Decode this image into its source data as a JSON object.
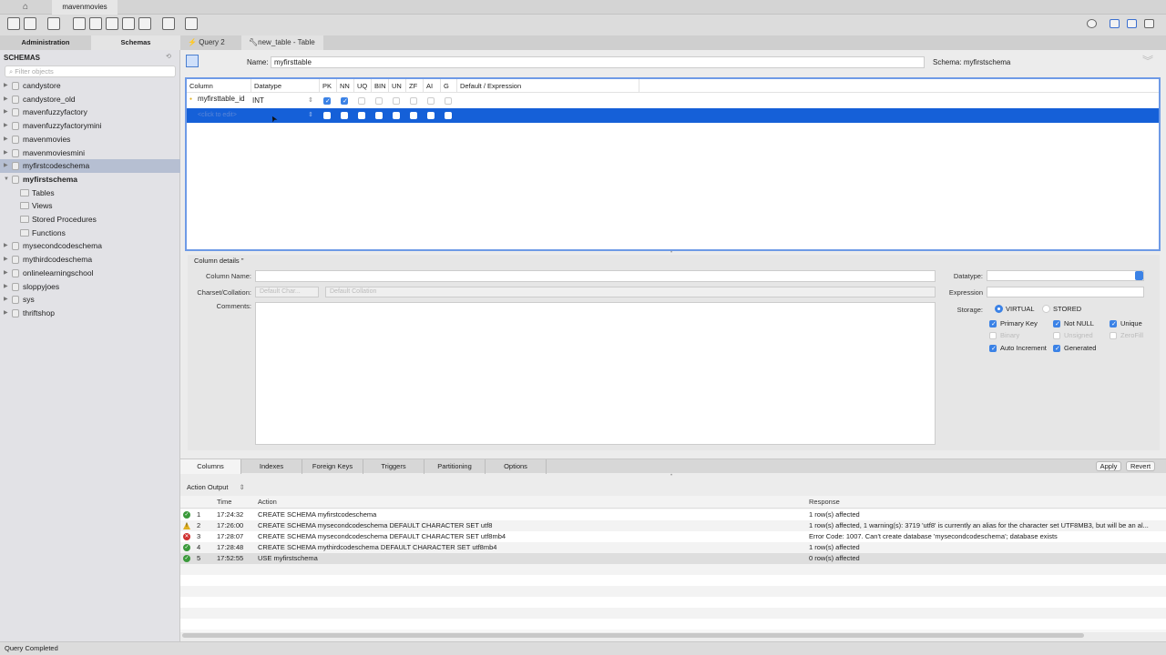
{
  "topbar": {
    "home_icon": "home-icon",
    "connection_tab": "mavenmovies"
  },
  "sidebar": {
    "tabs": [
      "Administration",
      "Schemas"
    ],
    "title": "SCHEMAS",
    "filter_placeholder": "Filter objects",
    "items": [
      {
        "label": "candystore",
        "level": 0
      },
      {
        "label": "candystore_old",
        "level": 0
      },
      {
        "label": "mavenfuzzyfactory",
        "level": 0
      },
      {
        "label": "mavenfuzzyfactorymini",
        "level": 0
      },
      {
        "label": "mavenmovies",
        "level": 0
      },
      {
        "label": "mavenmoviesmini",
        "level": 0
      },
      {
        "label": "myfirstcodeschema",
        "level": 0,
        "selected": true
      },
      {
        "label": "myfirstschema",
        "level": 0,
        "expanded": true,
        "bold": true
      },
      {
        "label": "Tables",
        "level": 1
      },
      {
        "label": "Views",
        "level": 1
      },
      {
        "label": "Stored Procedures",
        "level": 1
      },
      {
        "label": "Functions",
        "level": 1
      },
      {
        "label": "mysecondcodeschema",
        "level": 0
      },
      {
        "label": "mythirdcodeschema",
        "level": 0
      },
      {
        "label": "onlinelearningschool",
        "level": 0
      },
      {
        "label": "sloppyjoes",
        "level": 0
      },
      {
        "label": "sys",
        "level": 0
      },
      {
        "label": "thriftshop",
        "level": 0
      }
    ]
  },
  "editor": {
    "tabs": [
      "Query 2",
      "new_table - Table"
    ],
    "name_label": "Name:",
    "name_value": "myfirsttable",
    "schema_label": "Schema:",
    "schema_value": "myfirstschema",
    "grid_headers": [
      "Column",
      "Datatype",
      "PK",
      "NN",
      "UQ",
      "BIN",
      "UN",
      "ZF",
      "AI",
      "G",
      "Default / Expression"
    ],
    "rows": [
      {
        "column": "myfirsttable_id",
        "datatype": "INT",
        "flags": [
          true,
          true,
          false,
          false,
          false,
          false,
          false,
          false
        ]
      },
      {
        "column": "<click to edit>",
        "datatype": "",
        "flags": [
          false,
          false,
          false,
          false,
          false,
          false,
          false,
          false
        ],
        "selected": true
      }
    ]
  },
  "details": {
    "title": "Column details ''",
    "column_name_label": "Column Name:",
    "charset_label": "Charset/Collation:",
    "charset_value": "Default Char...",
    "collation_value": "Default Collation",
    "comments_label": "Comments:",
    "datatype_label": "Datatype:",
    "expression_label": "Expression",
    "storage_label": "Storage:",
    "storage_options": [
      "VIRTUAL",
      "STORED"
    ],
    "storage_selected": "VIRTUAL",
    "checks": [
      {
        "label": "Primary Key",
        "checked": true,
        "enabled": true
      },
      {
        "label": "Not NULL",
        "checked": true,
        "enabled": true
      },
      {
        "label": "Unique",
        "checked": true,
        "enabled": true
      },
      {
        "label": "Binary",
        "checked": false,
        "enabled": false
      },
      {
        "label": "Unsigned",
        "checked": false,
        "enabled": false
      },
      {
        "label": "ZeroFill",
        "checked": false,
        "enabled": false
      },
      {
        "label": "Auto Increment",
        "checked": true,
        "enabled": true
      },
      {
        "label": "Generated",
        "checked": true,
        "enabled": true
      }
    ]
  },
  "bottom_tabs": [
    "Columns",
    "Indexes",
    "Foreign Keys",
    "Triggers",
    "Partitioning",
    "Options"
  ],
  "buttons": {
    "apply": "Apply",
    "revert": "Revert"
  },
  "output": {
    "selector": "Action Output",
    "headers": [
      "Time",
      "Action",
      "Response"
    ],
    "rows": [
      {
        "status": "ok",
        "n": "1",
        "time": "17:24:32",
        "action": "CREATE SCHEMA myfirstcodeschema",
        "response": "1 row(s) affected"
      },
      {
        "status": "warning",
        "n": "2",
        "time": "17:26:00",
        "action": "CREATE SCHEMA mysecondcodeschema DEFAULT CHARACTER SET utf8",
        "response": "1 row(s) affected, 1 warning(s): 3719 'utf8' is currently an alias for the character set UTF8MB3, but will be an al..."
      },
      {
        "status": "error",
        "n": "3",
        "time": "17:28:07",
        "action": "CREATE SCHEMA mysecondcodeschema DEFAULT CHARACTER SET utf8mb4",
        "response": "Error Code: 1007. Can't create database 'mysecondcodeschema'; database exists"
      },
      {
        "status": "ok",
        "n": "4",
        "time": "17:28:48",
        "action": "CREATE SCHEMA mythirdcodeschema DEFAULT CHARACTER SET utf8mb4",
        "response": "1 row(s) affected"
      },
      {
        "status": "ok",
        "n": "5",
        "time": "17:52:55",
        "action": "USE myfirstschema",
        "response": "0 row(s) affected"
      }
    ]
  },
  "status_bar": "Query Completed",
  "colors": {
    "accent": "#3b82e6",
    "selection": "#1560d8",
    "ok": "#3a9a3a",
    "warning": "#e0b020",
    "error": "#d03030"
  }
}
